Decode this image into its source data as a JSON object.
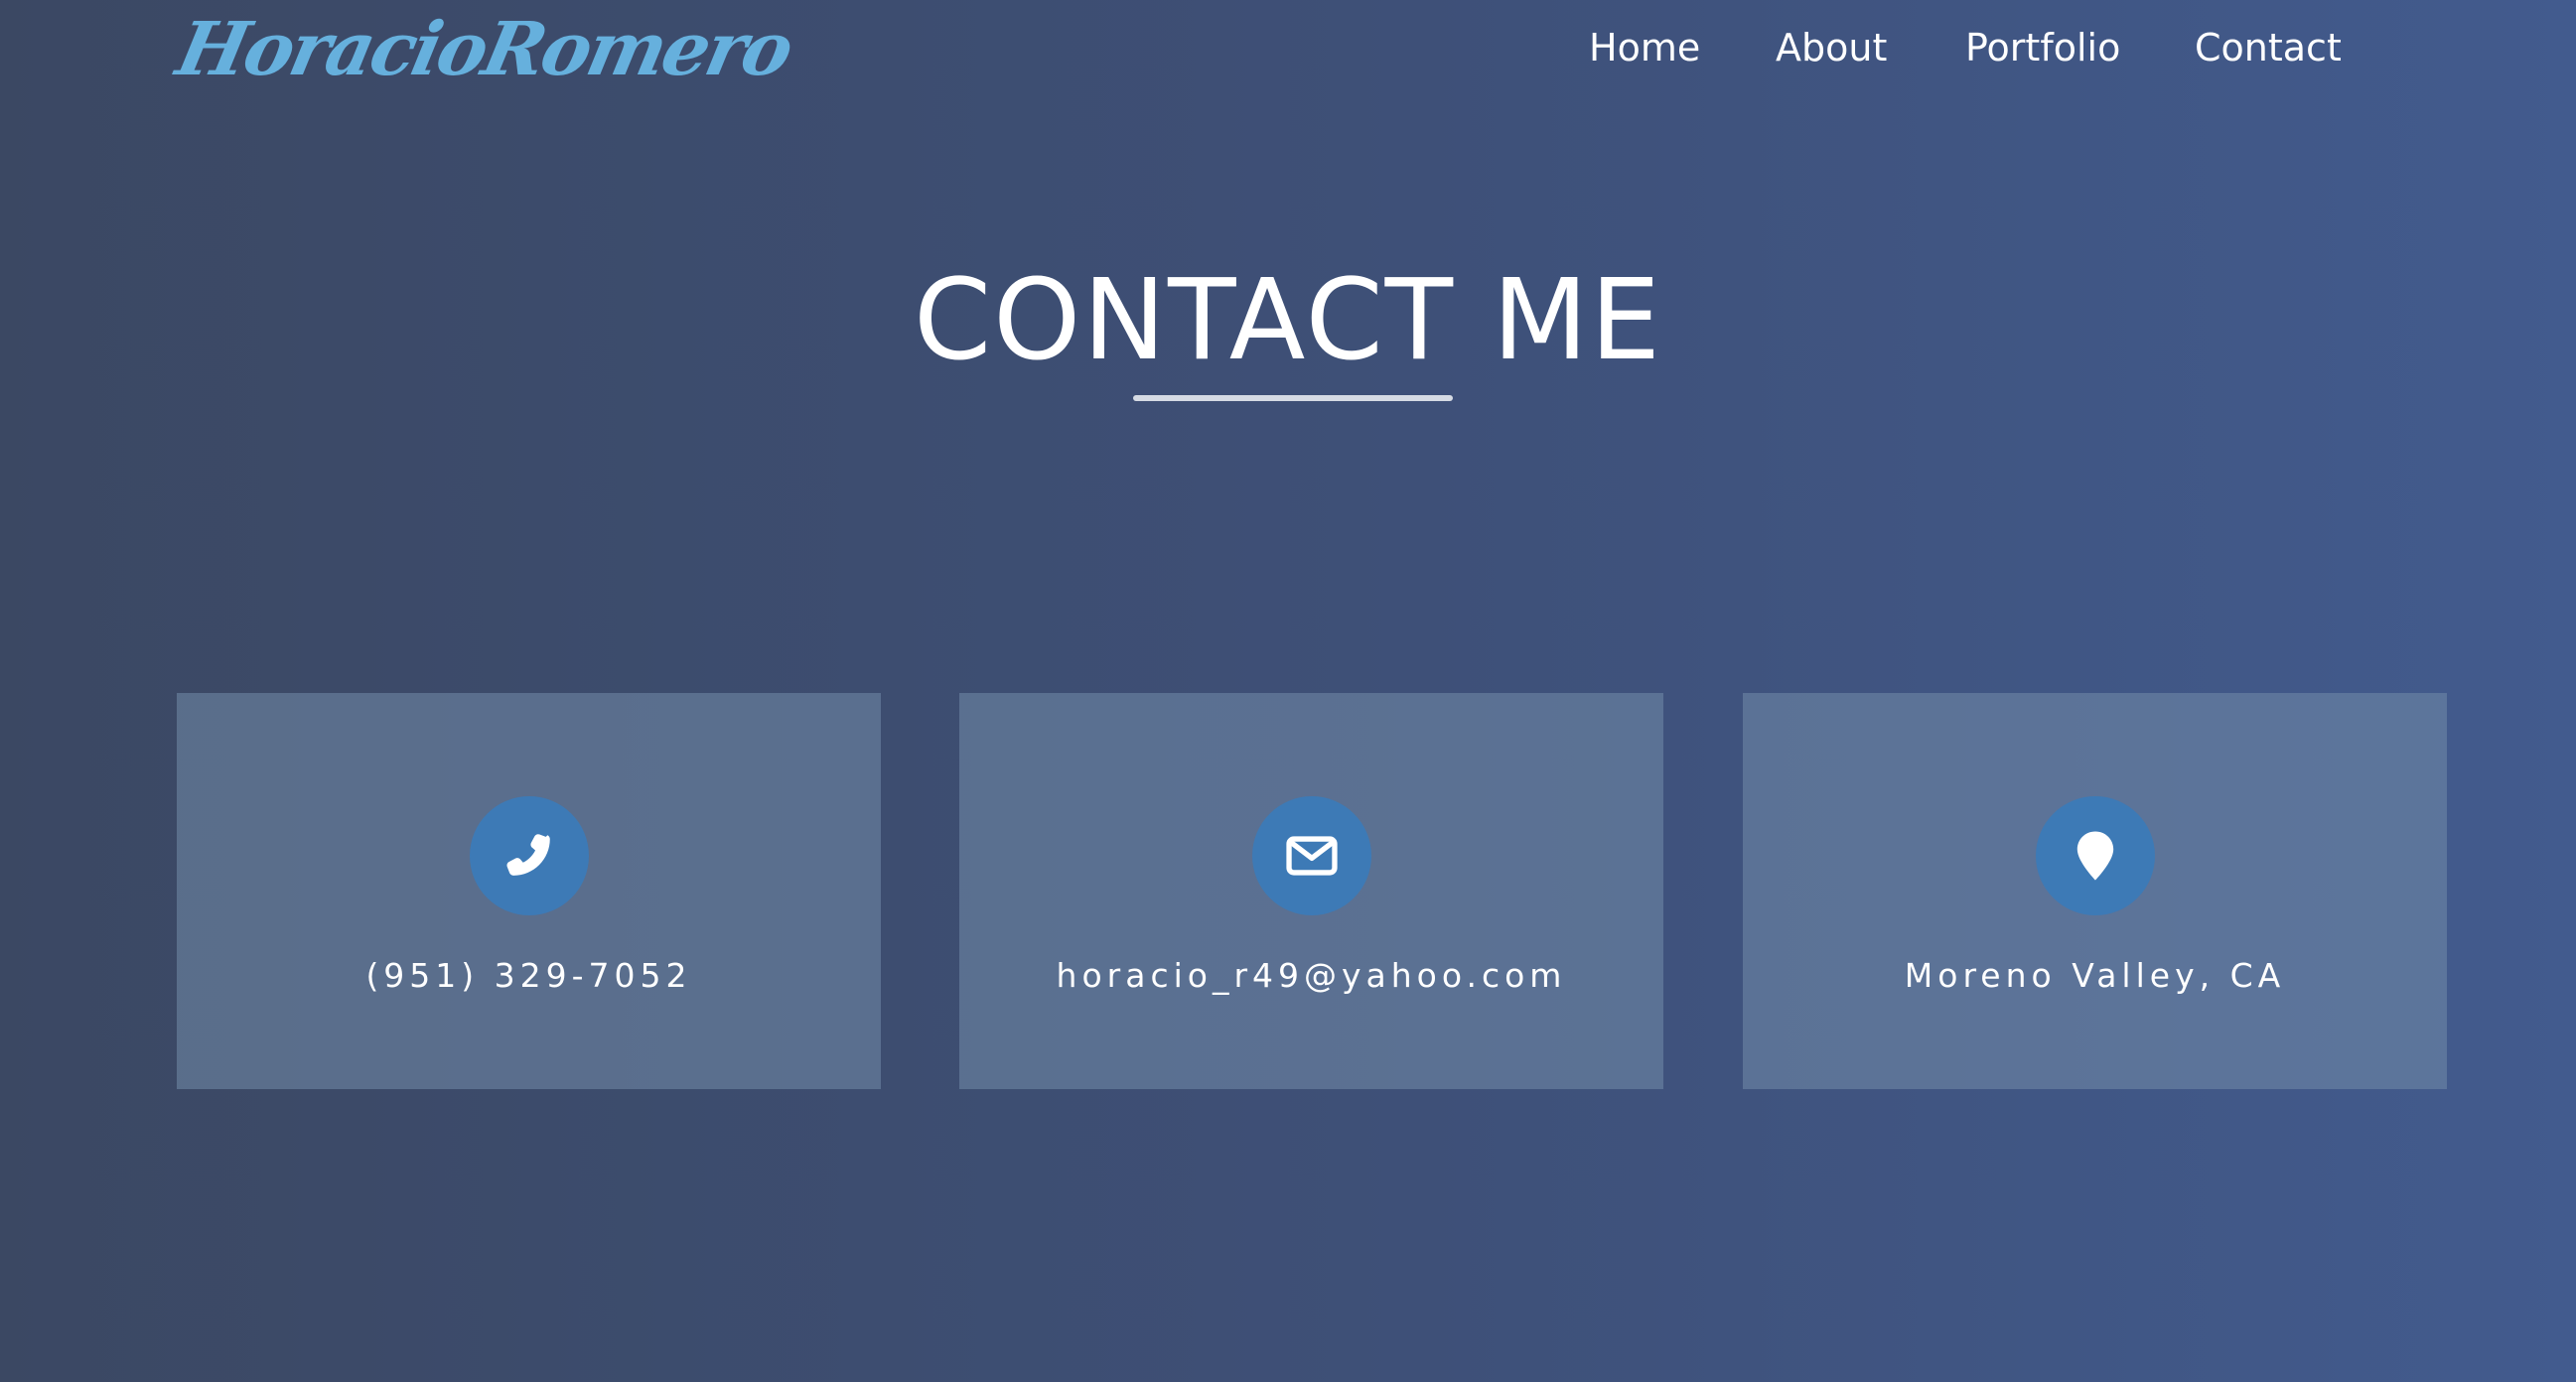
{
  "header": {
    "logo_text": "HoracioRomero",
    "nav": [
      {
        "label": "Home"
      },
      {
        "label": "About"
      },
      {
        "label": "Portfolio"
      },
      {
        "label": "Contact"
      }
    ]
  },
  "contact": {
    "title": "CONTACT ME",
    "cards": [
      {
        "icon": "phone-icon",
        "text": "(951) 329-7052"
      },
      {
        "icon": "envelope-icon",
        "text": "horacio_r49@yahoo.com"
      },
      {
        "icon": "map-marker-icon",
        "text": "Moreno Valley, CA"
      }
    ]
  },
  "colors": {
    "background_start": "#3b4863",
    "background_end": "#425b8e",
    "logo": "#66b0dd",
    "icon_circle": "#3d7ab6",
    "card_background": "#5a6e8e",
    "text": "#ffffff"
  }
}
